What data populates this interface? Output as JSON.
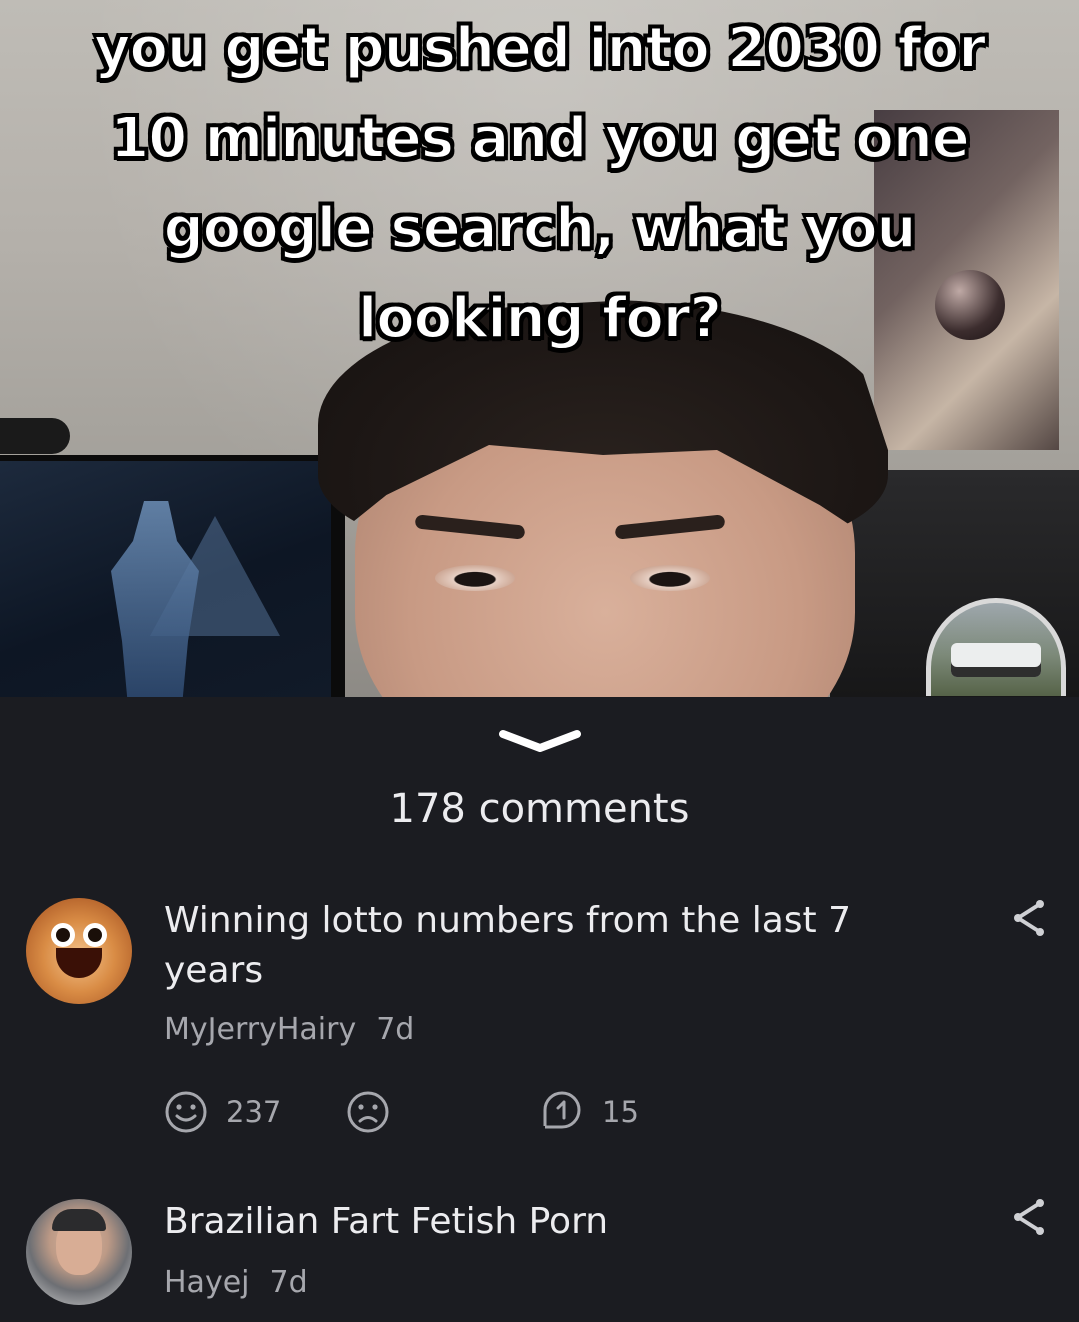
{
  "post": {
    "caption": "you get pushed into 2030 for 10 minutes and you get one google search, what you looking for?"
  },
  "comments_header": {
    "count_label": "178 comments"
  },
  "comments": [
    {
      "text": "Winning lotto numbers from the last 7 years",
      "author": "MyJerryHairy",
      "age": "7d",
      "upvotes": "237",
      "replies": "15"
    },
    {
      "text": "Brazilian Fart Fetish Porn",
      "author": "Hayej",
      "age": "7d"
    }
  ],
  "icons": {
    "collapse": "chevron-down-icon",
    "share": "share-icon",
    "like": "smile-icon",
    "dislike": "frown-icon",
    "reply": "reply-icon"
  },
  "colors": {
    "panel_background": "#1b1c21",
    "primary_text": "#ececef",
    "secondary_text": "#a6a7ad"
  }
}
